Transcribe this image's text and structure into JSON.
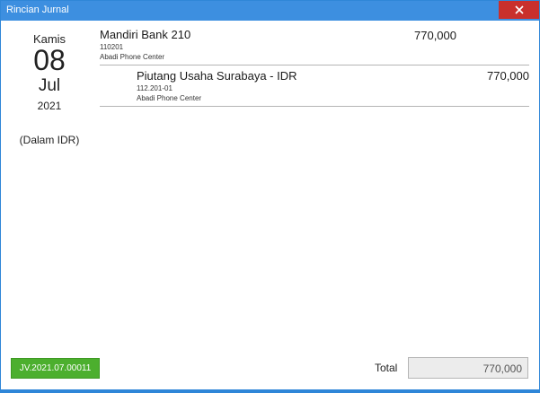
{
  "window": {
    "title": "Rincian Jurnal"
  },
  "date": {
    "day_name": "Kamis",
    "day": "08",
    "month": "Jul",
    "year": "2021",
    "currency_note": "(Dalam IDR)"
  },
  "entries": [
    {
      "account_name": "Mandiri Bank 210",
      "account_code": "110201",
      "department": "Abadi Phone Center",
      "amount": "770,000",
      "side": "debit"
    },
    {
      "account_name": "Piutang Usaha Surabaya - IDR",
      "account_code": "112.201-01",
      "department": "Abadi Phone Center",
      "amount": "770,000",
      "side": "credit"
    }
  ],
  "footer": {
    "journal_number": "JV.2021.07.00011",
    "total_label": "Total",
    "total_value": "770,000"
  },
  "colors": {
    "titlebar": "#3d8fe0",
    "close": "#c9302c",
    "journal_button": "#4caf2e"
  }
}
